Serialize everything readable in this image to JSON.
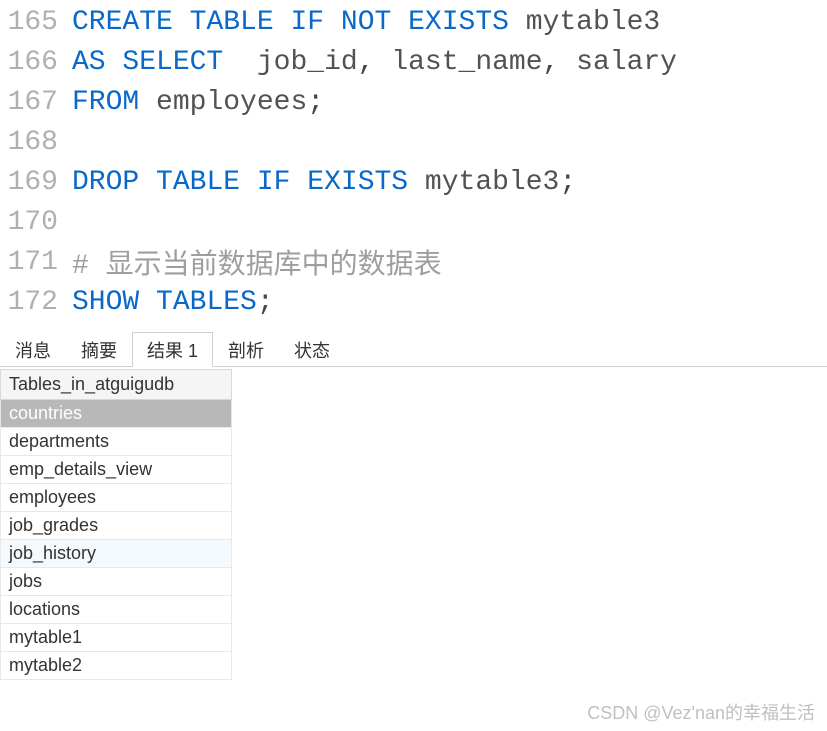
{
  "editor": {
    "lines": [
      {
        "no": "165"
      },
      {
        "no": "166"
      },
      {
        "no": "167"
      },
      {
        "no": "168"
      },
      {
        "no": "169"
      },
      {
        "no": "170"
      },
      {
        "no": "171"
      },
      {
        "no": "172"
      }
    ],
    "l165": {
      "kw1": "CREATE",
      "kw2": "TABLE",
      "kw3": "IF",
      "kw4": "NOT",
      "kw5": "EXISTS",
      "id1": "mytable3"
    },
    "l166": {
      "kw1": "AS",
      "kw2": "SELECT",
      "c1": "job_id",
      "c2": "last_name",
      "c3": "salary"
    },
    "l167": {
      "kw1": "FROM",
      "id1": "employees"
    },
    "l169": {
      "kw1": "DROP",
      "kw2": "TABLE",
      "kw3": "IF",
      "kw4": "EXISTS",
      "id1": "mytable3"
    },
    "l171": {
      "comment": "# 显示当前数据库中的数据表"
    },
    "l172": {
      "kw1": "SHOW",
      "kw2": "TABLES"
    }
  },
  "tabs": {
    "t1": "消息",
    "t2": "摘要",
    "t3": "结果 1",
    "t4": "剖析",
    "t5": "状态"
  },
  "result": {
    "header": "Tables_in_atguigudb",
    "rows": [
      "countries",
      "departments",
      "emp_details_view",
      "employees",
      "job_grades",
      "job_history",
      "jobs",
      "locations",
      "mytable1",
      "mytable2"
    ]
  },
  "watermark": "CSDN @Vez'nan的幸福生活"
}
